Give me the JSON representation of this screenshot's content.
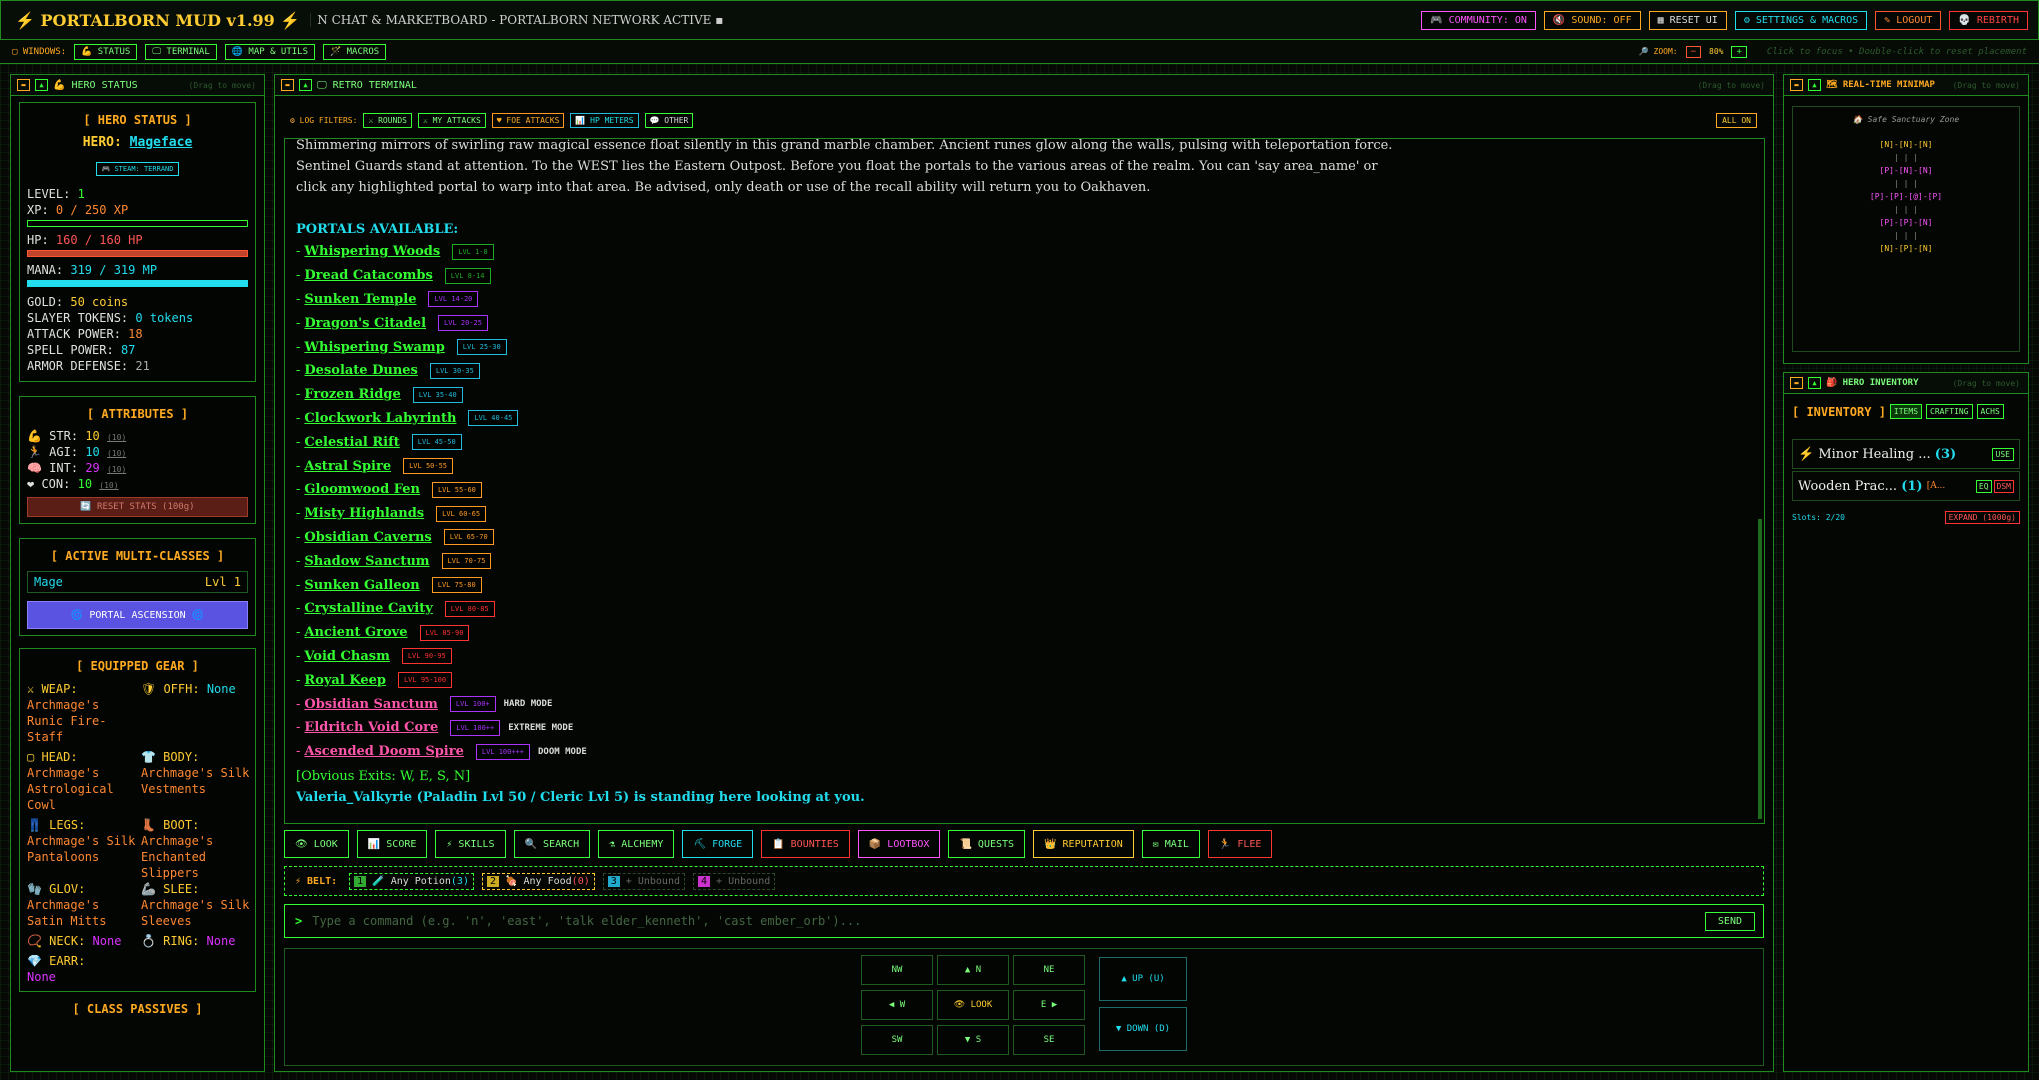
{
  "topbar": {
    "brand": "⚡ PORTALBORN MUD v1.99 ⚡",
    "ticker": "N CHAT & MARKETBOARD - PORTALBORN NETWORK ACTIVE ▪",
    "community": "🎮 COMMUNITY: ON",
    "sound": "🔇 SOUND: OFF",
    "reset_ui": "▦ RESET UI",
    "settings": "⚙ SETTINGS & MACROS",
    "logout": "✎ LOGOUT",
    "rebirth": "💀 REBIRTH"
  },
  "windows": {
    "label": "▢ WINDOWS:",
    "status": "💪 STATUS",
    "terminal": "🖵 TERMINAL",
    "map": "🌐 MAP & UTILS",
    "macros": "🪄 MACROS",
    "zoom_label": "🔎 ZOOM:",
    "zoom_minus": "−",
    "zoom_value": "80%",
    "zoom_plus": "+",
    "hint": "Click to focus • Double-click to reset placement"
  },
  "hero": {
    "title": "💪 HERO STATUS",
    "drag": "(Drag to move)",
    "section": "[ HERO STATUS ]",
    "hero_label": "HERO:",
    "hero_name": "Mageface",
    "steam": "🎮 STEAM: TERRAND",
    "level_label": "LEVEL:",
    "level": "1",
    "xp_label": "XP:",
    "xp": "0 / 250 XP",
    "hp_label": "HP:",
    "hp": "160 / 160 HP",
    "mana_label": "MANA:",
    "mana": "319 / 319 MP",
    "gold_label": "GOLD:",
    "gold": "50 coins",
    "slayer_label": "SLAYER TOKENS:",
    "slayer": "0 tokens",
    "attack_label": "ATTACK POWER:",
    "attack": "18",
    "spell_label": "SPELL POWER:",
    "spell": "87",
    "armor_label": "ARMOR DEFENSE:",
    "armor": "21",
    "xp_frac": 0.0,
    "hp_frac": 1.0,
    "mana_frac": 1.0
  },
  "attributes": {
    "title": "[ ATTRIBUTES ]",
    "str_label": "💪 STR:",
    "str": "10",
    "str_base": "(10)",
    "agi_label": "🏃 AGI:",
    "agi": "10",
    "agi_base": "(10)",
    "int_label": "🧠 INT:",
    "int": "29",
    "int_base": "(10)",
    "con_label": "❤ CON:",
    "con": "10",
    "con_base": "(10)",
    "reset": "🔄 RESET STATS (100g)"
  },
  "classes": {
    "title": "[ ACTIVE MULTI-CLASSES ]",
    "class_name": "Mage",
    "class_level": "Lvl 1",
    "ascension": "🌀 PORTAL ASCENSION 🌀"
  },
  "gear": {
    "title": "[ EQUIPPED GEAR ]",
    "weap_label": "⚔ WEAP:",
    "weap": "Archmage's Runic Fire-Staff",
    "offh_label": "🛡 OFFH:",
    "offh": "None",
    "head_label": "▢ HEAD:",
    "head": "Archmage's Astrological Cowl",
    "body_label": "👕 BODY:",
    "body": "Archmage's Silk Vestments",
    "legs_label": "👖 LEGS:",
    "legs": "Archmage's Silk Pantaloons",
    "boot_label": "👢 BOOT:",
    "boot": "Archmage's Enchanted Slippers",
    "glov_label": "🧤 GLOV:",
    "glov": "Archmage's Satin Mitts",
    "slee_label": "🦾 SLEE:",
    "slee": "Archmage's Silk Sleeves",
    "neck_label": "📿 NECK:",
    "neck": "None",
    "ring_label": "💍 RING:",
    "ring": "None",
    "earr_label": "💎 EARR:",
    "earr": "None",
    "passives": "[ CLASS PASSIVES ]"
  },
  "terminal": {
    "title": "🖵 RETRO TERMINAL",
    "drag": "(Drag to move)",
    "filters_label": "⚙ LOG FILTERS:",
    "f_rounds": "⚔ ROUNDS",
    "f_my": "⚔ MY ATTACKS",
    "f_foe": "♥ FOE ATTACKS",
    "f_hp": "📊 HP METERS",
    "f_other": "💬 OTHER",
    "all_on": "ALL ON",
    "lines": [
      "Shimmering mirrors of swirling raw magical essence float silently in this grand marble chamber. Ancient runes glow along the walls, pulsing with teleportation force.",
      "Sentinel Guards stand at attention. To the WEST lies the Eastern Outpost. Before you float the portals to the various areas of the realm. You can 'say area_name' or",
      "click any highlighted portal to warp into that area. Be advised, only death or use of the recall ability will return you to Oakhaven."
    ],
    "portals_heading": "PORTALS AVAILABLE:",
    "portals": [
      {
        "name": "Whispering Woods",
        "lvl": "LVL 1-8",
        "color": "#33ff33",
        "bcolor": "#22aa22",
        "mode": ""
      },
      {
        "name": "Dread Catacombs",
        "lvl": "LVL 8-14",
        "color": "#33ff33",
        "bcolor": "#22aa22",
        "mode": ""
      },
      {
        "name": "Sunken Temple",
        "lvl": "LVL 14-20",
        "color": "#33ff33",
        "bcolor": "#aa33ff",
        "mode": ""
      },
      {
        "name": "Dragon's Citadel",
        "lvl": "LVL 20-25",
        "color": "#33ff33",
        "bcolor": "#aa33ff",
        "mode": ""
      },
      {
        "name": "Whispering Swamp",
        "lvl": "LVL 25-30",
        "color": "#33ff33",
        "bcolor": "#22bbdd",
        "mode": ""
      },
      {
        "name": "Desolate Dunes",
        "lvl": "LVL 30-35",
        "color": "#33ff33",
        "bcolor": "#22bbdd",
        "mode": ""
      },
      {
        "name": "Frozen Ridge",
        "lvl": "LVL 35-40",
        "color": "#33ff33",
        "bcolor": "#22bbdd",
        "mode": ""
      },
      {
        "name": "Clockwork Labyrinth",
        "lvl": "LVL 40-45",
        "color": "#33ff33",
        "bcolor": "#22bbdd",
        "mode": ""
      },
      {
        "name": "Celestial Rift",
        "lvl": "LVL 45-50",
        "color": "#33ff33",
        "bcolor": "#22bbdd",
        "mode": ""
      },
      {
        "name": "Astral Spire",
        "lvl": "LVL 50-55",
        "color": "#33ff33",
        "bcolor": "#ff9922",
        "mode": ""
      },
      {
        "name": "Gloomwood Fen",
        "lvl": "LVL 55-60",
        "color": "#33ff33",
        "bcolor": "#ff9922",
        "mode": ""
      },
      {
        "name": "Misty Highlands",
        "lvl": "LVL 60-65",
        "color": "#33ff33",
        "bcolor": "#ff9922",
        "mode": ""
      },
      {
        "name": "Obsidian Caverns",
        "lvl": "LVL 65-70",
        "color": "#33ff33",
        "bcolor": "#ff9922",
        "mode": ""
      },
      {
        "name": "Shadow Sanctum",
        "lvl": "LVL 70-75",
        "color": "#33ff33",
        "bcolor": "#ff9922",
        "mode": ""
      },
      {
        "name": "Sunken Galleon",
        "lvl": "LVL 75-80",
        "color": "#33ff33",
        "bcolor": "#ff9922",
        "mode": ""
      },
      {
        "name": "Crystalline Cavity",
        "lvl": "LVL 80-85",
        "color": "#33ff33",
        "bcolor": "#ff3333",
        "mode": ""
      },
      {
        "name": "Ancient Grove",
        "lvl": "LVL 85-90",
        "color": "#33ff33",
        "bcolor": "#ff3333",
        "mode": ""
      },
      {
        "name": "Void Chasm",
        "lvl": "LVL 90-95",
        "color": "#33ff33",
        "bcolor": "#ff3333",
        "mode": ""
      },
      {
        "name": "Royal Keep",
        "lvl": "LVL 95-100",
        "color": "#33ff33",
        "bcolor": "#ff3333",
        "mode": ""
      },
      {
        "name": "Obsidian Sanctum",
        "lvl": "LVL 100+",
        "color": "#ff55aa",
        "bcolor": "#aa33ff",
        "mode": "HARD MODE"
      },
      {
        "name": "Eldritch Void Core",
        "lvl": "LVL 100++",
        "color": "#ff55aa",
        "bcolor": "#aa33ff",
        "mode": "EXTREME MODE"
      },
      {
        "name": "Ascended Doom Spire",
        "lvl": "LVL 100+++",
        "color": "#ff55aa",
        "bcolor": "#aa33ff",
        "mode": "DOOM MODE"
      }
    ],
    "exits": "[Obvious Exits: W, E, S, N]",
    "presence": "Valeria_Valkyrie (Paladin Lvl 50 / Cleric Lvl 5) is standing here looking at you."
  },
  "actions": {
    "look": "👁 LOOK",
    "score": "📊 SCORE",
    "skills": "⚡ SKILLS",
    "search": "🔍 SEARCH",
    "alchemy": "⚗ ALCHEMY",
    "forge": "⛏ FORGE",
    "bounties": "📋 BOUNTIES",
    "lootbox": "📦 LOOTBOX",
    "quests": "📜 QUESTS",
    "reputation": "👑 REPUTATION",
    "mail": "✉ MAIL",
    "flee": "🏃 FLEE"
  },
  "belt": {
    "label": "⚡ BELT:",
    "s1_key": "1",
    "s1": "🧪 Any Potion",
    "s1_count": "(3)",
    "s2_key": "2",
    "s2": "🍖 Any Food",
    "s2_count": "(0)",
    "s3_key": "3",
    "s3": "+ Unbound",
    "s4_key": "4",
    "s4": "+ Unbound"
  },
  "command": {
    "prompt": ">",
    "placeholder": "Type a command (e.g. 'n', 'east', 'talk elder_kenneth', 'cast ember_orb')...",
    "send": "SEND"
  },
  "compass": {
    "nw": "NW",
    "n": "▲ N",
    "ne": "NE",
    "w": "◀ W",
    "look": "👁 LOOK",
    "e": "E ▶",
    "sw": "SW",
    "s": "▼ S",
    "se": "SE",
    "up": "▲ UP (U)",
    "down": "▼ DOWN (D)"
  },
  "minimap": {
    "title": "🗺 REAL-TIME MINIMAP",
    "drag": "(Drag to move)",
    "zone": "🏠 Safe Sanctuary Zone",
    "r1": "[N]-[N]-[N]",
    "r1b": "|  |  |",
    "r2": "[P]-[N]-[N]",
    "r2b": "|  |  |",
    "r3": "[P]-[P]-[@]-[P]",
    "r3b": "|  |  |",
    "r4": "[P]-[P]-[N]",
    "r4b": "|  |  |",
    "r5": "[N]-[P]-[N]"
  },
  "inventory": {
    "title": "🎒 HERO INVENTORY",
    "drag": "(Drag to move)",
    "heading": "[ INVENTORY ]",
    "tab_items": "ITEMS",
    "tab_crafting": "CRAFTING",
    "tab_achs": "ACHS",
    "item1": "⚡ Minor Healing ...",
    "item1_count": "(3)",
    "item1_use": "USE",
    "item2": "Wooden Prac...",
    "item2_count": "(1)",
    "item2_tag": "[A...",
    "item2_eq": "EQ",
    "item2_dsm": "DSM",
    "slots": "Slots: 2/20",
    "expand": "EXPAND (1000g)"
  }
}
